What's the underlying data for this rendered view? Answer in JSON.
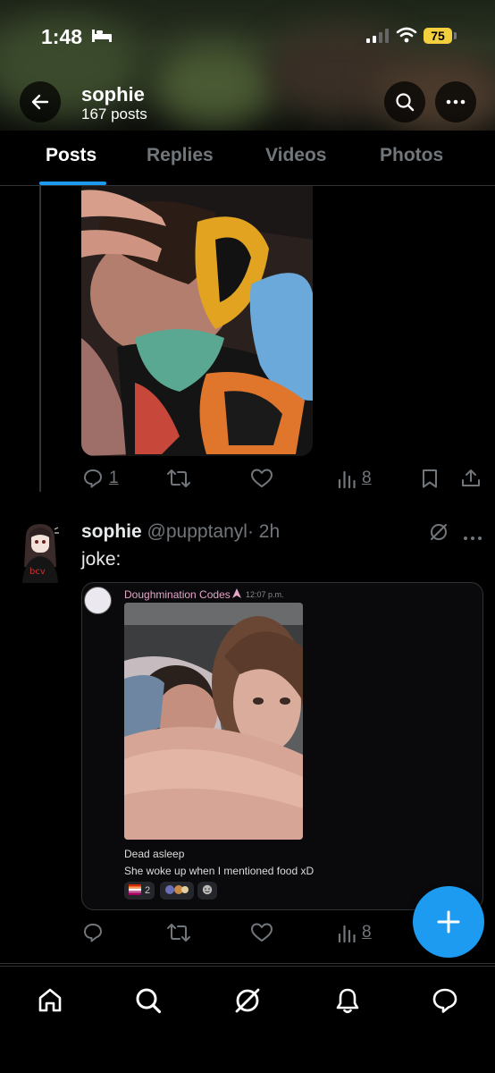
{
  "status_bar": {
    "time": "1:48",
    "battery": "75"
  },
  "profile": {
    "name": "sophie",
    "post_count": "167 posts"
  },
  "tabs": [
    {
      "label": "Posts",
      "active": true
    },
    {
      "label": "Replies",
      "active": false
    },
    {
      "label": "Videos",
      "active": false
    },
    {
      "label": "Photos",
      "active": false
    }
  ],
  "post1": {
    "replies": "1",
    "views": "8"
  },
  "post2": {
    "name": "sophie",
    "handle": "@pupptanyl",
    "time": "· 2h",
    "text": "joke:",
    "views": "8",
    "embed": {
      "author": "Doughmination Codes",
      "time": "12:07 p.m.",
      "line1": "Dead asleep",
      "line2": "She woke up when I mentioned food xD",
      "reaction_count": "2"
    }
  },
  "colors": {
    "accent": "#1d9bf0",
    "muted": "#71767b",
    "background": "#000000"
  },
  "icons": [
    "back-arrow-icon",
    "search-icon",
    "more-icon",
    "reply-icon",
    "repost-icon",
    "like-icon",
    "views-icon",
    "bookmark-icon",
    "share-icon",
    "grok-icon",
    "plus-icon",
    "home-icon",
    "notifications-icon",
    "messages-icon"
  ]
}
